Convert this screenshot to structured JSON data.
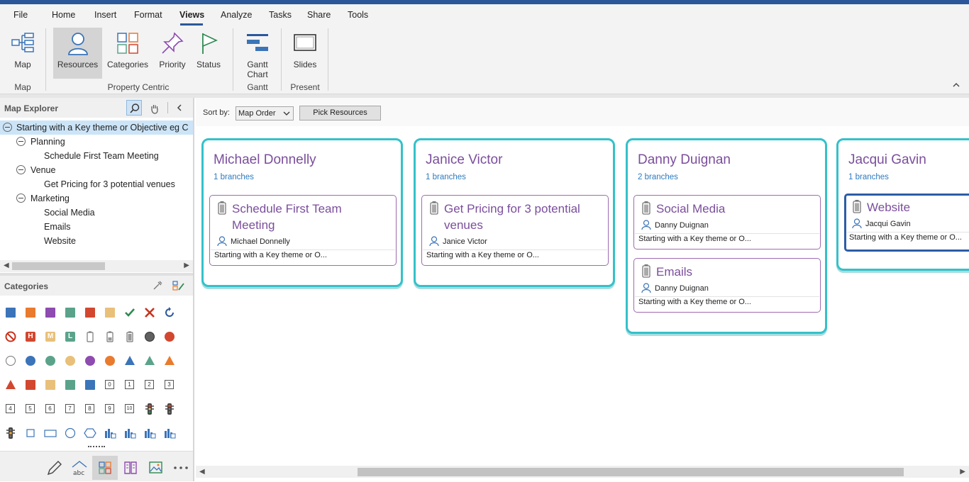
{
  "menu": [
    "File",
    "Home",
    "Insert",
    "Format",
    "Views",
    "Analyze",
    "Tasks",
    "Share",
    "Tools"
  ],
  "menu_active": "Views",
  "ribbon": {
    "buttons": {
      "map": "Map",
      "resources": "Resources",
      "categories": "Categories",
      "priority": "Priority",
      "status": "Status",
      "gantt_line1": "Gantt",
      "gantt_line2": "Chart",
      "slides": "Slides"
    },
    "groups": {
      "map": "Map",
      "property_centric": "Property Centric",
      "gantt": "Gantt",
      "present": "Present"
    }
  },
  "map_explorer": {
    "title": "Map Explorer",
    "tree": [
      {
        "label": "Starting with a Key theme or Objective eg C",
        "level": 0,
        "toggle": true,
        "selected": true
      },
      {
        "label": "Planning",
        "level": 1,
        "toggle": true
      },
      {
        "label": "Schedule First Team Meeting",
        "level": 2,
        "toggle": false
      },
      {
        "label": "Venue",
        "level": 1,
        "toggle": true
      },
      {
        "label": "Get Pricing for 3 potential venues",
        "level": 2,
        "toggle": false
      },
      {
        "label": "Marketing",
        "level": 1,
        "toggle": true
      },
      {
        "label": "Social Media",
        "level": 2,
        "toggle": false
      },
      {
        "label": "Emails",
        "level": 2,
        "toggle": false
      },
      {
        "label": "Website",
        "level": 2,
        "toggle": false
      }
    ]
  },
  "categories_panel": {
    "title": "Categories",
    "numbers": [
      "0",
      "1",
      "2",
      "3",
      "4",
      "5",
      "6",
      "7",
      "8",
      "9",
      "10"
    ],
    "letters": [
      "H",
      "M",
      "L"
    ],
    "colors": {
      "blue": "#3b74b8",
      "orange": "#e97b2e",
      "purple": "#8e4bb0",
      "green": "#5aa38a",
      "red": "#d2472f",
      "tan": "#e9c07a",
      "check": "#2f8a52",
      "x": "#c8321c"
    }
  },
  "toolbar": {
    "sort_label": "Sort by:",
    "sort_value": "Map Order",
    "pick_button": "Pick Resources"
  },
  "columns": [
    {
      "name": "Michael Donnelly",
      "branches": "1 branches",
      "cards": [
        {
          "title_lines": [
            "Schedule First Team",
            "Meeting"
          ],
          "resource": "Michael Donnelly",
          "parent": "Starting with a Key theme or O...",
          "selected": false
        }
      ]
    },
    {
      "name": "Janice Victor",
      "branches": "1 branches",
      "cards": [
        {
          "title_lines": [
            "Get Pricing for 3 potential",
            "venues"
          ],
          "resource": "Janice Victor",
          "parent": "Starting with a Key theme or O...",
          "selected": false
        }
      ]
    },
    {
      "name": "Danny Duignan",
      "branches": "2 branches",
      "cards": [
        {
          "title_lines": [
            "Social Media"
          ],
          "resource": "Danny Duignan",
          "parent": "Starting with a Key theme or O...",
          "selected": false
        },
        {
          "title_lines": [
            "Emails"
          ],
          "resource": "Danny Duignan",
          "parent": "Starting with a Key theme or O...",
          "selected": false
        }
      ]
    },
    {
      "name": "Jacqui Gavin",
      "branches": "1 branches",
      "cards": [
        {
          "title_lines": [
            "Website"
          ],
          "resource": "Jacqui Gavin",
          "parent": "Starting with a Key theme or O...",
          "selected": true
        }
      ]
    }
  ]
}
